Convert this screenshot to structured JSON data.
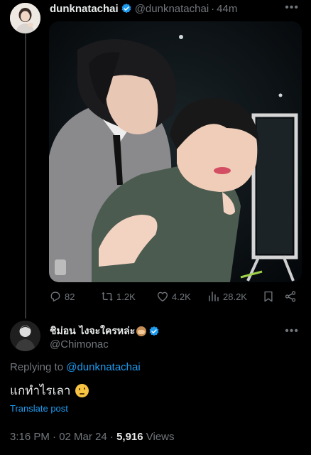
{
  "parent_tweet": {
    "display_name": "dunknatachai",
    "handle": "@dunknatachai",
    "separator": "·",
    "time": "44m",
    "more_label": "•••",
    "photo_alt": "",
    "actions": {
      "replies": "82",
      "reposts": "1.2K",
      "likes": "4.2K",
      "views": "28.2K"
    }
  },
  "reply_tweet": {
    "display_name": "ชิม่อน ไงจะใครหล่ะ",
    "handle": "@Chimonac",
    "more_label": "•••",
    "replying_prefix": "Replying to",
    "replying_to": "@dunknatachai",
    "text": "แกทำไรเลา",
    "translate_label": "Translate post",
    "timestamp": "3:16 PM · 02 Mar 24 · ",
    "views_count": "5,916",
    "views_label": " Views"
  },
  "colors": {
    "background": "#000000",
    "text_primary": "#e7e9ea",
    "text_secondary": "#71767b",
    "accent": "#1d9bf0",
    "verified": "#1d9bf0"
  },
  "icons": [
    "reply-icon",
    "repost-icon",
    "like-icon",
    "views-icon",
    "bookmark-icon",
    "share-icon",
    "verified-badge-icon",
    "more-icon"
  ]
}
